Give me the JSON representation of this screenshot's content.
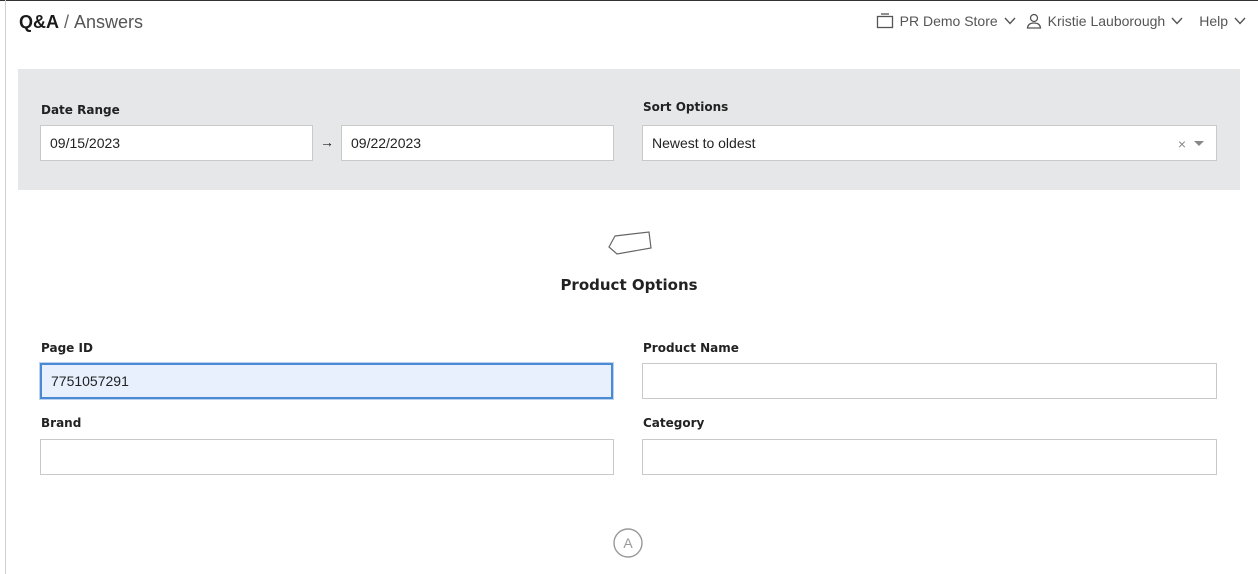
{
  "breadcrumb": {
    "root": "Q&A",
    "separator": "/",
    "page": "Answers"
  },
  "topnav": {
    "store_label": "PR Demo Store",
    "user_label": "Kristie Lauborough",
    "help_label": "Help"
  },
  "filters": {
    "date_range_label": "Date Range",
    "date_from": "09/15/2023",
    "date_arrow": "→",
    "date_to": "09/22/2023",
    "sort_label": "Sort Options",
    "sort_value": "Newest to oldest",
    "sort_clear": "×"
  },
  "product_options": {
    "title": "Product Options",
    "page_id_label": "Page ID",
    "page_id_value": "7751057291",
    "product_name_label": "Product Name",
    "product_name_value": "",
    "brand_label": "Brand",
    "brand_value": "",
    "category_label": "Category",
    "category_value": ""
  },
  "answer_section": {
    "icon_letter": "A"
  },
  "icons": {
    "store": "store-icon",
    "user": "user-icon",
    "chevron": "chevron-down-icon",
    "tag": "tag-icon"
  }
}
